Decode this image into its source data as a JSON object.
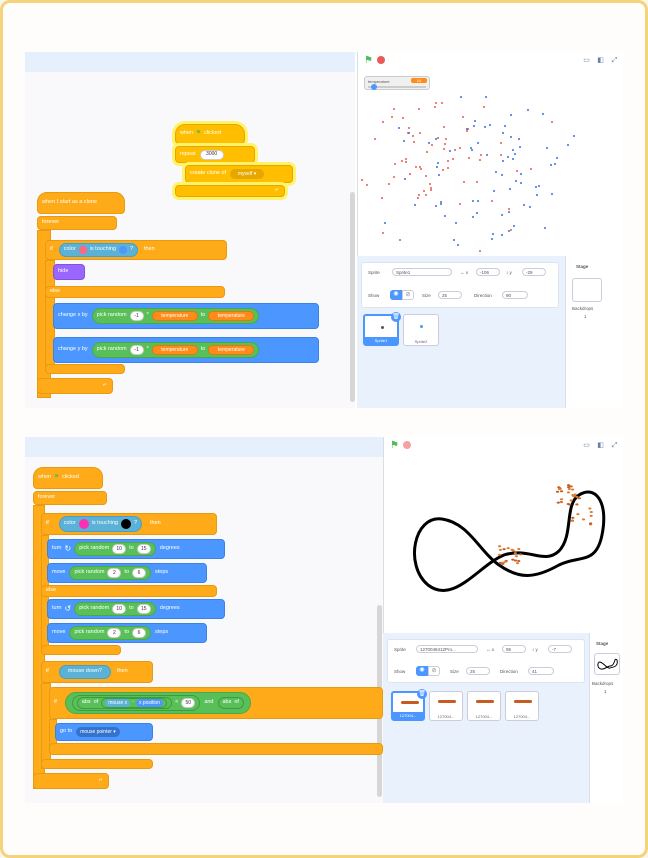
{
  "colors": {
    "frame": "#f6d37a",
    "orange": "#ffab19",
    "green": "#59c059",
    "blue": "#4c97ff",
    "lightblue": "#5cb1d6",
    "purple": "#9966ff",
    "red_dot": "#e85a4f",
    "blue_dot": "#3d6fe0"
  },
  "top": {
    "code": {
      "hat1": {
        "when": "when",
        "flag_icon": "green-flag-icon",
        "clicked": "clicked"
      },
      "repeat": {
        "label": "repeat",
        "value": "3000"
      },
      "create_clone": {
        "label": "create clone of",
        "value": "myself"
      },
      "hat2": {
        "label": "when I start as a clone"
      },
      "forever": {
        "label": "forever"
      },
      "if": {
        "if": "if",
        "color": "color",
        "is_touching": "is touching",
        "q": "?",
        "then": "then",
        "color1": "#ff6680",
        "color2": "#4c97ff"
      },
      "hide": {
        "label": "hide"
      },
      "else": {
        "label": "else"
      },
      "change_x": {
        "label": "change x by",
        "pick": "pick random",
        "v1": "-1",
        "star": "*",
        "var": "temperature",
        "to": "to",
        "var2": "temperature"
      },
      "change_y": {
        "label": "change y by",
        "pick": "pick random",
        "v1": "-1",
        "star": "*",
        "var": "temperature",
        "to": "to",
        "var2": "temperature"
      }
    },
    "stage": {
      "monitor": {
        "name": "temperature",
        "value": "10"
      },
      "fullscreen_icons": [
        "layout-small-icon",
        "layout-large-icon",
        "fullscreen-icon"
      ]
    },
    "info": {
      "sprite_label": "Sprite",
      "sprite_name": "Sprite1",
      "x_label": "x",
      "x": "-106",
      "y_label": "y",
      "y": "-29",
      "show_label": "Show",
      "size_label": "Size",
      "size": "25",
      "direction_label": "Direction",
      "direction": "90",
      "stage_label": "Stage",
      "backdrops_label": "Backdrops",
      "backdrops": "1",
      "sprites": [
        "Sprite1",
        "Sprite2"
      ]
    }
  },
  "bottom": {
    "code": {
      "hat": {
        "when": "when",
        "clicked": "clicked"
      },
      "forever": {
        "label": "forever"
      },
      "if": {
        "if": "if",
        "color": "color",
        "is_touching": "is touching",
        "q": "?",
        "then": "then",
        "color1": "#ff2fb4",
        "color2": "#000000"
      },
      "turn1": {
        "label": "turn",
        "pick": "pick random",
        "a": "10",
        "to": "to",
        "b": "15",
        "unit": "degrees"
      },
      "move1": {
        "label": "move",
        "pick": "pick random",
        "a": "2",
        "to": "to",
        "b": "6",
        "unit": "steps"
      },
      "else": {
        "label": "else"
      },
      "turn2": {
        "label": "turn",
        "pick": "pick random",
        "a": "10",
        "to": "to",
        "b": "15",
        "unit": "degrees"
      },
      "move2": {
        "label": "move",
        "pick": "pick random",
        "a": "2",
        "to": "to",
        "b": "6",
        "unit": "steps"
      },
      "if_mouse": {
        "if": "if",
        "cond": "mouse down?",
        "then": "then"
      },
      "if2": {
        "if": "if",
        "abs": "abs",
        "of": "of",
        "mouse": "mouse x",
        "minus": "-",
        "xpos": "x position",
        "lt": "<",
        "val": "50",
        "and": "and",
        "abs2": "abs",
        "of2": "of"
      },
      "goto": {
        "label": "go to",
        "value": "mouse pointer"
      }
    },
    "info": {
      "sprite_label": "Sprite",
      "sprite_name": "1270048412Pro...",
      "x_label": "x",
      "x": "95",
      "y_label": "y",
      "y": "-7",
      "show_label": "Show",
      "size_label": "Size",
      "size": "25",
      "direction_label": "Direction",
      "direction": "41",
      "stage_label": "Stage",
      "backdrops_label": "Backdrops",
      "backdrops": "1",
      "sprites": [
        "127004...",
        "127004...",
        "127004...",
        "127004..."
      ]
    }
  }
}
